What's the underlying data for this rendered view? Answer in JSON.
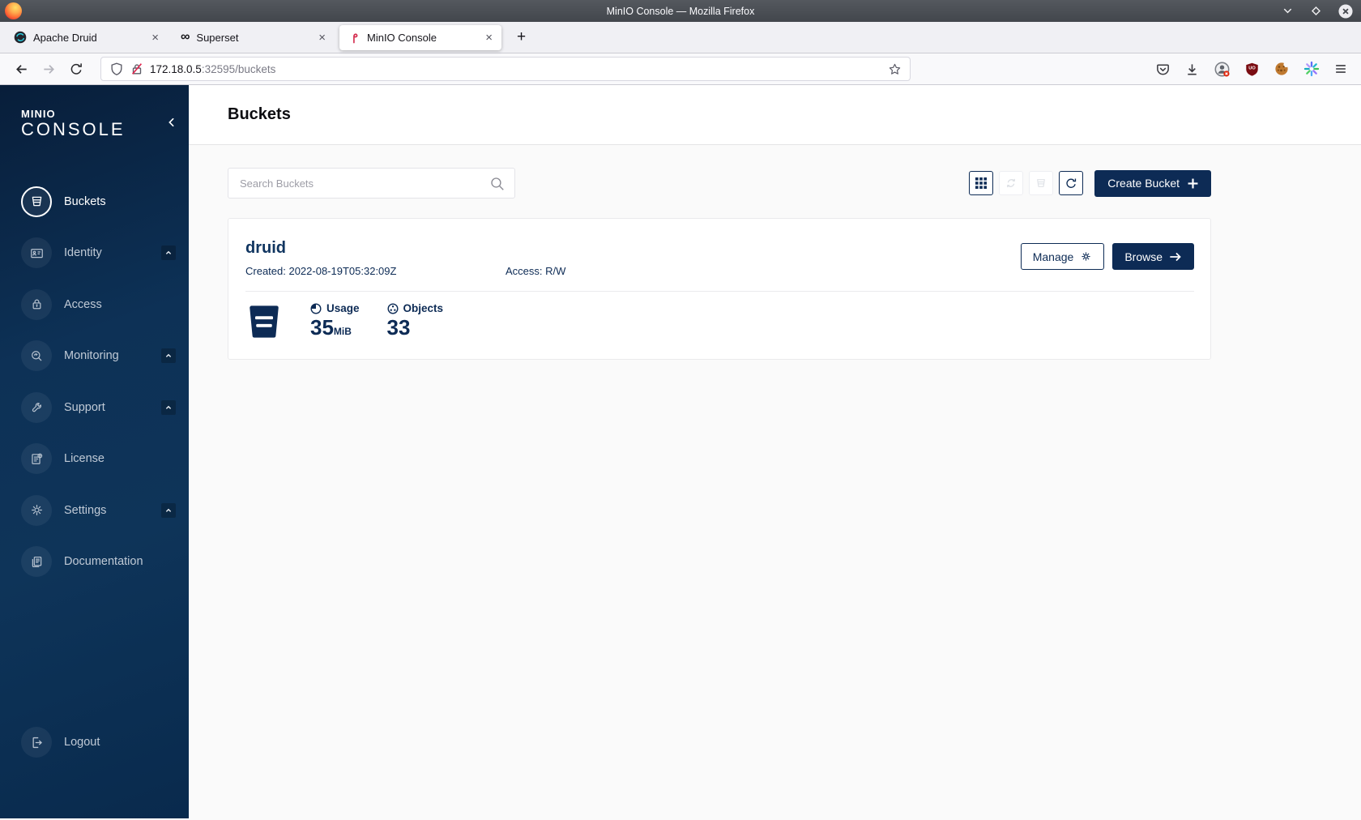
{
  "window": {
    "title": "MinIO Console — Mozilla Firefox",
    "tabs": [
      {
        "label": "Apache Druid"
      },
      {
        "label": "Superset"
      },
      {
        "label": "MinIO Console"
      }
    ],
    "new_tab_glyph": "+",
    "close_tab_glyph": "×",
    "url": {
      "host": "172.18.0.5",
      "rest": ":32595/buckets"
    }
  },
  "glyphs": {
    "superset_infinity": "∞"
  },
  "sidebar": {
    "logo_top": "MINIO",
    "logo_bottom": "CONSOLE",
    "items": [
      {
        "label": "Buckets"
      },
      {
        "label": "Identity"
      },
      {
        "label": "Access"
      },
      {
        "label": "Monitoring"
      },
      {
        "label": "Support"
      },
      {
        "label": "License"
      },
      {
        "label": "Settings"
      },
      {
        "label": "Documentation"
      }
    ],
    "logout_label": "Logout"
  },
  "main": {
    "page_title": "Buckets",
    "search": {
      "placeholder": "Search Buckets"
    },
    "create_bucket_label": "Create Bucket",
    "bucket": {
      "name": "druid",
      "created": "Created: 2022-08-19T05:32:09Z",
      "access": "Access: R/W",
      "usage_label": "Usage",
      "usage_value": "35",
      "usage_unit": "MiB",
      "objects_label": "Objects",
      "objects_value": "33",
      "manage_label": "Manage",
      "browse_label": "Browse"
    }
  },
  "colors": {
    "accent_navy": "#0d2b55",
    "sidebar_gradient_start": "#081e3a",
    "sidebar_gradient_mid": "#0e3459",
    "titlebar": "#4a4e54",
    "ublock_red": "#7a0c12",
    "lock_slash_red": "#e22850"
  }
}
